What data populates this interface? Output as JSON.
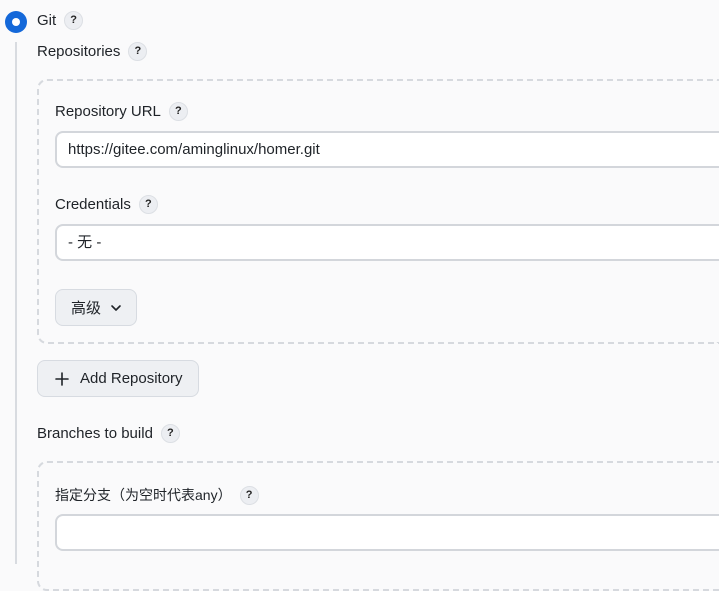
{
  "scm": {
    "label": "Git",
    "help": "?",
    "repositories_label": "Repositories",
    "repository": {
      "url_label": "Repository URL",
      "url_value": "https://gitee.com/aminglinux/homer.git",
      "credentials_label": "Credentials",
      "credentials_value": "- 无 -",
      "advanced_label": "高级"
    },
    "add_repository_label": "Add Repository",
    "branches_label": "Branches to build",
    "branch_spec_label": "指定分支（为空时代表any）",
    "branch_spec_value": ""
  }
}
